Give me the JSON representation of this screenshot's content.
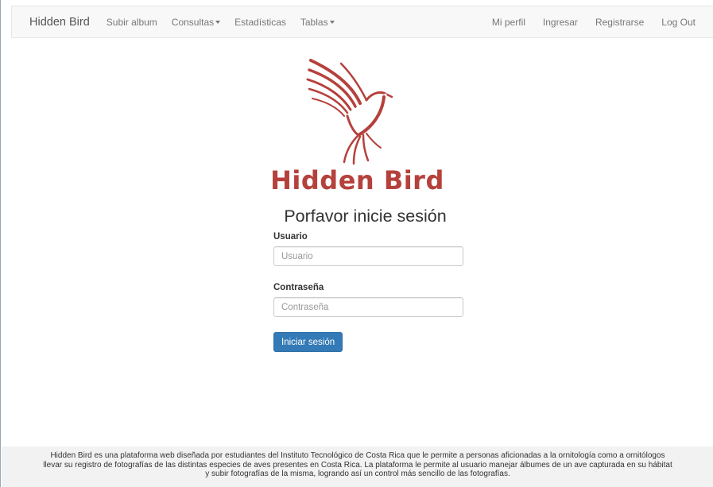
{
  "navbar": {
    "brand": "Hidden Bird",
    "left_items": [
      {
        "label": "Subir album",
        "dropdown": false
      },
      {
        "label": "Consultas",
        "dropdown": true
      },
      {
        "label": "Estadísticas",
        "dropdown": false
      },
      {
        "label": "Tablas",
        "dropdown": true
      }
    ],
    "right_items": [
      {
        "label": "Mi perfil"
      },
      {
        "label": "Ingresar"
      },
      {
        "label": "Registrarse"
      },
      {
        "label": "Log Out"
      }
    ]
  },
  "logo": {
    "icon": "bird-icon",
    "text": "Hidden Bird",
    "color": "#b5413c"
  },
  "login": {
    "heading": "Porfavor inicie sesión",
    "username_label": "Usuario",
    "username_placeholder": "Usuario",
    "username_value": "",
    "password_label": "Contraseña",
    "password_placeholder": "Contraseña",
    "password_value": "",
    "submit_label": "Iniciar sesión",
    "button_color": "#337ab7"
  },
  "footer": {
    "line1": "Hidden Bird es una plataforma web diseñada por estudiantes del Instituto Tecnológico de Costa Rica que le permite a personas aficionadas a la ornitología como a ornitólogos",
    "line2": "llevar su registro de fotografías de las distintas especies de aves presentes en Costa Rica. La plataforma le permite al usuario manejar álbumes de un ave capturada en su hábitat",
    "line3": "y subir fotografías de la misma, logrando así un control más sencillo de las fotografías."
  }
}
